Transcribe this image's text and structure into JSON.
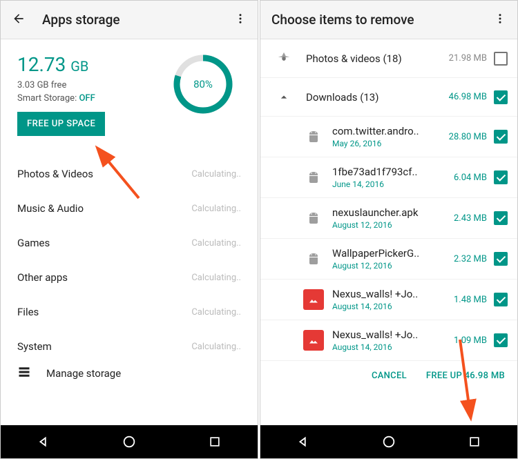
{
  "colors": {
    "teal": "#009688",
    "arrow": "#f4511e"
  },
  "left": {
    "title": "Apps storage",
    "total": "12.73",
    "unit": "GB",
    "free_line": "3.03 GB free",
    "smart_label": "Smart Storage: ",
    "smart_value": "OFF",
    "button": "FREE UP SPACE",
    "percent": "80%",
    "percent_value": 80,
    "categories": [
      {
        "name": "Photos & Videos",
        "status": "Calculating.."
      },
      {
        "name": "Music & Audio",
        "status": "Calculating.."
      },
      {
        "name": "Games",
        "status": "Calculating.."
      },
      {
        "name": "Other apps",
        "status": "Calculating.."
      },
      {
        "name": "Files",
        "status": "Calculating.."
      },
      {
        "name": "System",
        "status": "Calculating.."
      }
    ],
    "manage": "Manage storage"
  },
  "right": {
    "title": "Choose items to remove",
    "groups": [
      {
        "icon": "photos",
        "name": "Photos & videos (18)",
        "size": "21.98 MB",
        "checked": false,
        "size_color": "gray"
      },
      {
        "icon": "expand",
        "name": "Downloads (13)",
        "size": "46.98 MB",
        "checked": true,
        "size_color": "teal"
      }
    ],
    "children": [
      {
        "type": "apk",
        "name": "com.twitter.andro..",
        "date": "May 26, 2016",
        "size": "28.80 MB"
      },
      {
        "type": "apk",
        "name": "1fbe73ad1f793cf..",
        "date": "June 14, 2016",
        "size": "6.04 MB"
      },
      {
        "type": "apk",
        "name": "nexuslauncher.apk",
        "date": "August 12, 2016",
        "size": "2.43 MB"
      },
      {
        "type": "apk",
        "name": "WallpaperPickerG..",
        "date": "August 12, 2016",
        "size": "2.32 MB"
      },
      {
        "type": "img",
        "name": "Nexus_walls! +Jo..",
        "date": "August 14, 2016",
        "size": "1.48 MB"
      },
      {
        "type": "img",
        "name": "Nexus_walls! +Jo..",
        "date": "August 14, 2016",
        "size": "1.09 MB"
      }
    ],
    "cancel": "CANCEL",
    "free_up": "FREE UP 46.98 MB"
  }
}
